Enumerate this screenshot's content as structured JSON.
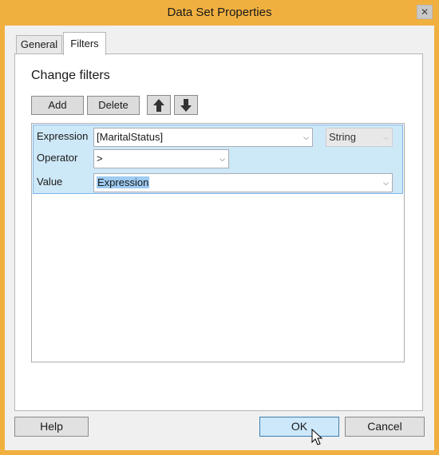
{
  "window": {
    "title": "Data Set Properties",
    "close_glyph": "✕"
  },
  "tabs": [
    {
      "label": "General",
      "active": false
    },
    {
      "label": "Filters",
      "active": true
    }
  ],
  "panel": {
    "heading": "Change filters",
    "toolbar": {
      "add_label": "Add",
      "delete_label": "Delete",
      "move_up_icon": "arrow-up-icon",
      "move_down_icon": "arrow-down-icon"
    },
    "filter": {
      "expression_label": "Expression",
      "expression_value": "[MaritalStatus]",
      "type_value": "String",
      "operator_label": "Operator",
      "operator_value": ">",
      "value_label": "Value",
      "value_value": "Expression"
    }
  },
  "footer": {
    "help_label": "Help",
    "ok_label": "OK",
    "cancel_label": "Cancel"
  },
  "colors": {
    "titlebar": "#f0b040",
    "selection": "#cde8f7",
    "ok_button": "#cde8fb"
  }
}
